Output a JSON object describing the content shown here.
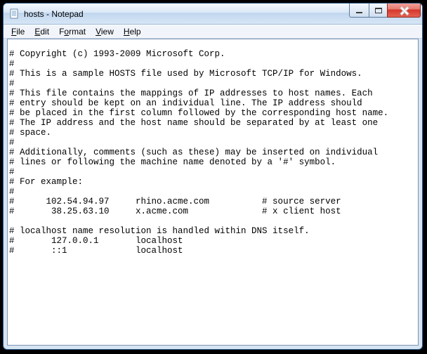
{
  "window": {
    "title": "hosts - Notepad"
  },
  "menubar": {
    "file": "File",
    "edit": "Edit",
    "format": "Format",
    "view": "View",
    "help": "Help"
  },
  "hosts_file": {
    "copyright": "# Copyright (c) 1993-2009 Microsoft Corp.",
    "desc1": "# This is a sample HOSTS file used by Microsoft TCP/IP for Windows.",
    "para1_l1": "# This file contains the mappings of IP addresses to host names. Each",
    "para1_l2": "# entry should be kept on an individual line. The IP address should",
    "para1_l3": "# be placed in the first column followed by the corresponding host name.",
    "para1_l4": "# The IP address and the host name should be separated by at least one",
    "para1_l5": "# space.",
    "para2_l1": "# Additionally, comments (such as these) may be inserted on individual",
    "para2_l2": "# lines or following the machine name denoted by a '#' symbol.",
    "example_hdr": "# For example:",
    "example1": "#      102.54.94.97     rhino.acme.com          # source server",
    "example2": "#       38.25.63.10     x.acme.com              # x client host",
    "dns_note": "# localhost name resolution is handled within DNS itself.",
    "entry1": "#       127.0.0.1       localhost",
    "entry2": "#       ::1             localhost"
  }
}
